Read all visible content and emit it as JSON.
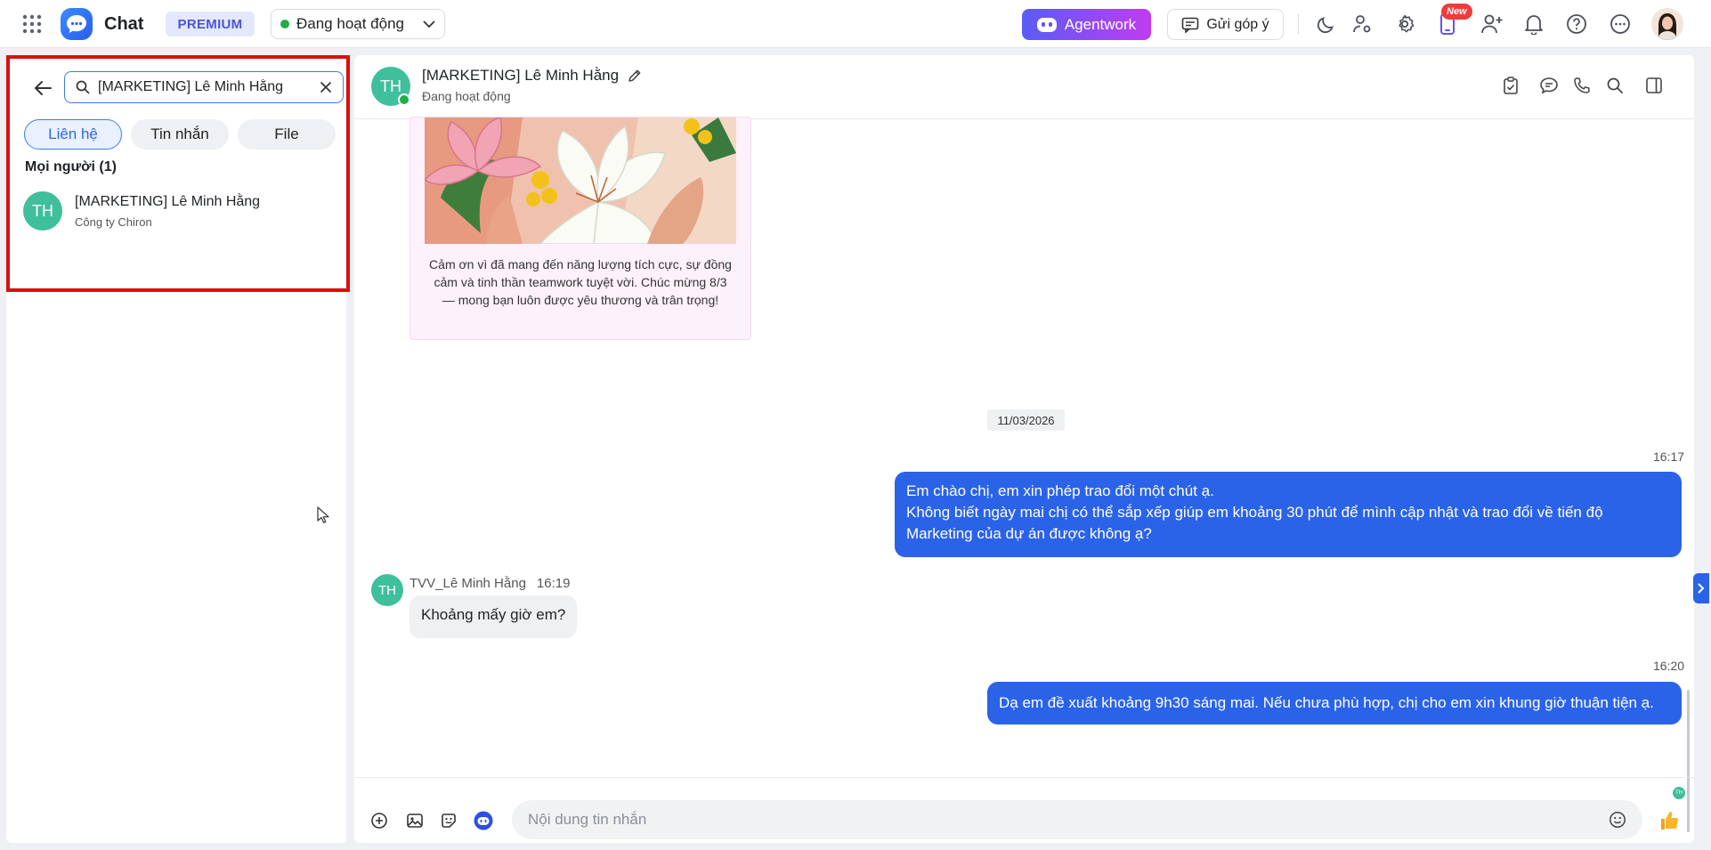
{
  "topbar": {
    "app_name": "Chat",
    "premium_label": "PREMIUM",
    "status_label": "Đang hoạt động",
    "agentwork_label": "Agentwork",
    "feedback_label": "Gửi góp ý",
    "new_badge": "New"
  },
  "sidebar": {
    "search_value": "[MARKETING] Lê Minh Hằng",
    "tabs": [
      {
        "label": "Liên hệ",
        "active": true
      },
      {
        "label": "Tin nhắn",
        "active": false
      },
      {
        "label": "File",
        "active": false
      }
    ],
    "section_title": "Mọi người (1)",
    "contact": {
      "initials": "TH",
      "name": "[MARKETING] Lê Minh Hằng",
      "company": "Công ty Chiron"
    }
  },
  "chat": {
    "header": {
      "initials": "TH",
      "name": "[MARKETING] Lê Minh Hằng",
      "status": "Đang hoạt động"
    },
    "card_caption": "Cảm ơn vì đã mang đến năng lượng tích cực, sự đồng cảm và tinh thần teamwork tuyệt vời. Chúc mừng 8/3 — mong bạn luôn được yêu thương và trân trọng!",
    "date_divider": "11/03/2026",
    "messages": [
      {
        "time": "16:17",
        "text_line1": "Em chào chị, em xin phép trao đổi một chút ạ.",
        "text_line2": "Không biết ngày mai chị có thể sắp xếp giúp em khoảng 30 phút để mình cập nhật và trao đổi về tiến độ Marketing của dự án được không ạ?"
      },
      {
        "sender": "TVV_Lê Minh Hằng",
        "initials": "TH",
        "time": "16:19",
        "text": "Khoảng mấy giờ em?"
      },
      {
        "time": "16:20",
        "text": "Dạ em đề xuất khoảng 9h30 sáng mai. Nếu chưa phù hợp, chị cho em xin khung giờ thuận tiện ạ.",
        "seen_initials": "TH"
      }
    ],
    "composer_placeholder": "Nội dung tin nhắn"
  },
  "colors": {
    "accent": "#2b63e8",
    "avatar": "#3fbf9b",
    "online": "#1fae48",
    "highlight": "#d90f0f"
  }
}
